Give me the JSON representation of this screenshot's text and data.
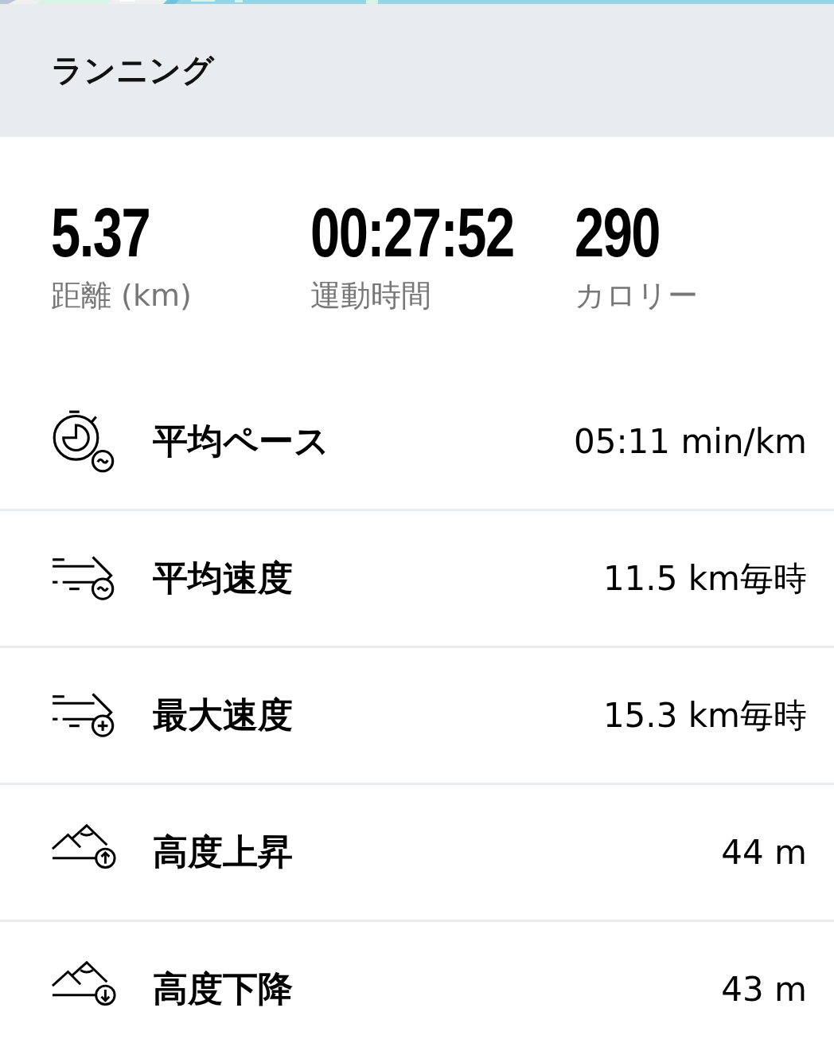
{
  "header": {
    "title": "ランニング"
  },
  "summary": [
    {
      "value": "5.37",
      "label": "距離 (km)"
    },
    {
      "value": "00:27:52",
      "label": "運動時間"
    },
    {
      "value": "290",
      "label": "カロリー"
    }
  ],
  "metrics": [
    {
      "kind": "pace",
      "label": "平均ペース",
      "value": "05:11 min/km"
    },
    {
      "kind": "avg-speed",
      "label": "平均速度",
      "value": "11.5 km毎時"
    },
    {
      "kind": "max-speed",
      "label": "最大速度",
      "value": "15.3 km毎時"
    },
    {
      "kind": "ascent",
      "label": "高度上昇",
      "value": "44 m"
    },
    {
      "kind": "descent",
      "label": "高度下降",
      "value": "43 m"
    }
  ]
}
